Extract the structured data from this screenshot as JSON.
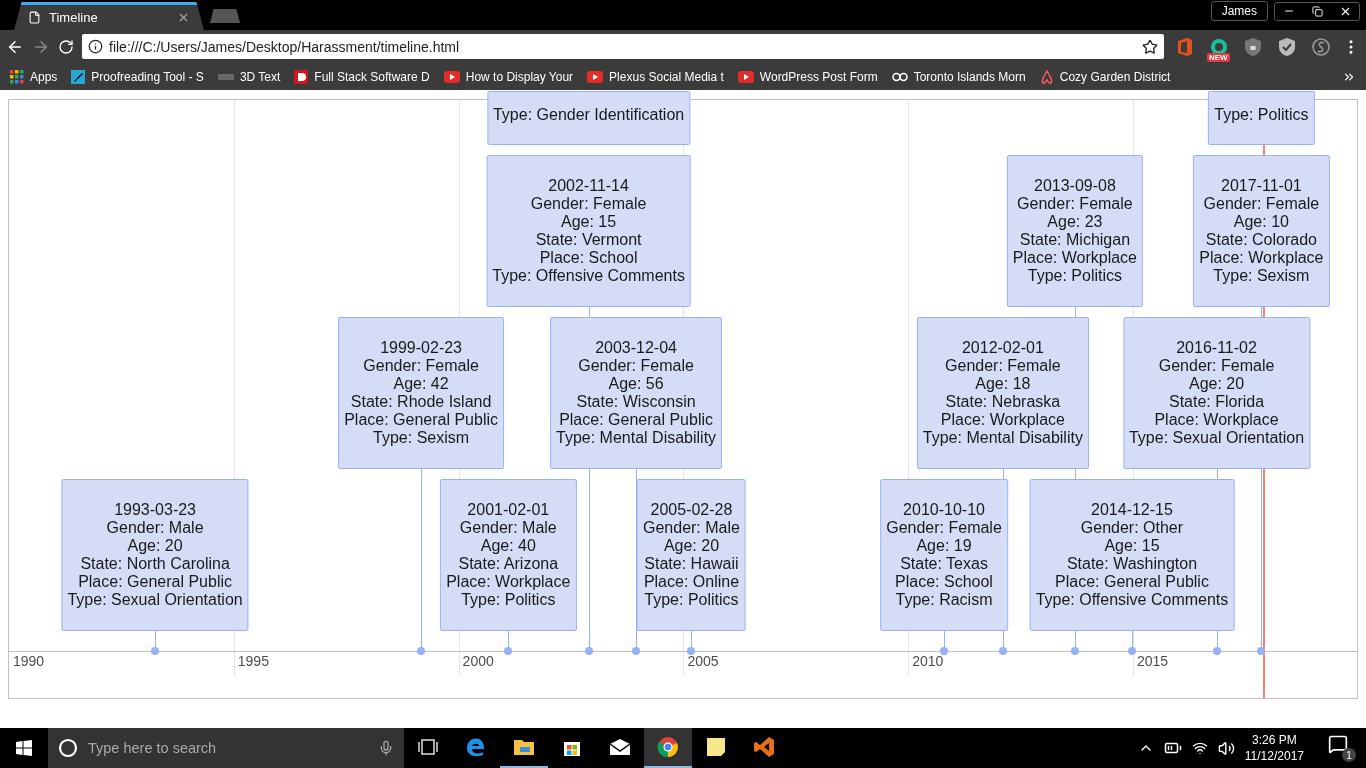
{
  "browser": {
    "tabs": [
      {
        "label": "Timeline",
        "selected": true
      }
    ],
    "profile": "James",
    "address": "file:///C:/Users/James/Desktop/Harassment/timeline.html",
    "extension_badge": "NEW",
    "bookmarks": [
      {
        "kind": "apps",
        "label": "Apps"
      },
      {
        "kind": "proofread",
        "label": "Proofreading Tool - S"
      },
      {
        "kind": "text3d",
        "label": "3D Text"
      },
      {
        "kind": "dlogo",
        "label": "Full Stack Software D"
      },
      {
        "kind": "youtube",
        "label": "How to Display Your"
      },
      {
        "kind": "youtube",
        "label": "Plexus Social Media t"
      },
      {
        "kind": "youtube",
        "label": "WordPress Post Form"
      },
      {
        "kind": "tripadvisor",
        "label": "Toronto Islands Morn"
      },
      {
        "kind": "airbnb",
        "label": "Cozy Garden District"
      }
    ]
  },
  "timeline": {
    "axis_labels": [
      "1990",
      "1995",
      "2000",
      "2005",
      "2010",
      "2015"
    ],
    "rows": [
      {
        "items": [
          {
            "details": [
              "Type: Gender Identification"
            ]
          },
          {
            "details": [
              "Type: Politics"
            ]
          }
        ]
      },
      {
        "items": [
          {
            "date": "2002-11-14",
            "details": [
              "Gender: Female",
              "Age: 15",
              "State: Vermont",
              "Place: School",
              "Type: Offensive Comments"
            ]
          },
          {
            "date": "2013-09-08",
            "details": [
              "Gender: Female",
              "Age: 23",
              "State: Michigan",
              "Place: Workplace",
              "Type: Politics"
            ]
          },
          {
            "date": "2017-11-01",
            "details": [
              "Gender: Female",
              "Age: 10",
              "State: Colorado",
              "Place: Workplace",
              "Type: Sexism"
            ]
          }
        ]
      },
      {
        "items": [
          {
            "date": "1999-02-23",
            "details": [
              "Gender: Female",
              "Age: 42",
              "State: Rhode Island",
              "Place: General Public",
              "Type: Sexism"
            ]
          },
          {
            "date": "2003-12-04",
            "details": [
              "Gender: Female",
              "Age: 56",
              "State: Wisconsin",
              "Place: General Public",
              "Type: Mental Disability"
            ]
          },
          {
            "date": "2012-02-01",
            "details": [
              "Gender: Female",
              "Age: 18",
              "State: Nebraska",
              "Place: Workplace",
              "Type: Mental Disability"
            ]
          },
          {
            "date": "2016-11-02",
            "details": [
              "Gender: Female",
              "Age: 20",
              "State: Florida",
              "Place: Workplace",
              "Type: Sexual Orientation"
            ]
          }
        ]
      },
      {
        "items": [
          {
            "date": "1993-03-23",
            "details": [
              "Gender: Male",
              "Age: 20",
              "State: North Carolina",
              "Place: General Public",
              "Type: Sexual Orientation"
            ]
          },
          {
            "date": "2001-02-01",
            "details": [
              "Gender: Male",
              "Age: 40",
              "State: Arizona",
              "Place: Workplace",
              "Type: Politics"
            ]
          },
          {
            "date": "2005-02-28",
            "details": [
              "Gender: Male",
              "Age: 20",
              "State: Hawaii",
              "Place: Online",
              "Type: Politics"
            ]
          },
          {
            "date": "2010-10-10",
            "details": [
              "Gender: Female",
              "Age: 19",
              "State: Texas",
              "Place: School",
              "Type: Racism"
            ]
          },
          {
            "date": "2014-12-15",
            "details": [
              "Gender: Other",
              "Age: 15",
              "State: Washington",
              "Place: General Public",
              "Type: Offensive Comments"
            ]
          }
        ]
      }
    ]
  },
  "taskbar": {
    "search_placeholder": "Type here to search",
    "apps": [
      {
        "kind": "edge",
        "running": false,
        "selected": false
      },
      {
        "kind": "explorer",
        "running": true,
        "selected": false
      },
      {
        "kind": "store",
        "running": false,
        "selected": false
      },
      {
        "kind": "mail",
        "running": false,
        "selected": false
      },
      {
        "kind": "chrome",
        "running": true,
        "selected": true
      },
      {
        "kind": "notes",
        "running": false,
        "selected": false
      },
      {
        "kind": "vs",
        "running": false,
        "selected": false
      }
    ],
    "time": "3:26 PM",
    "date": "11/12/2017",
    "notifications": "1"
  }
}
